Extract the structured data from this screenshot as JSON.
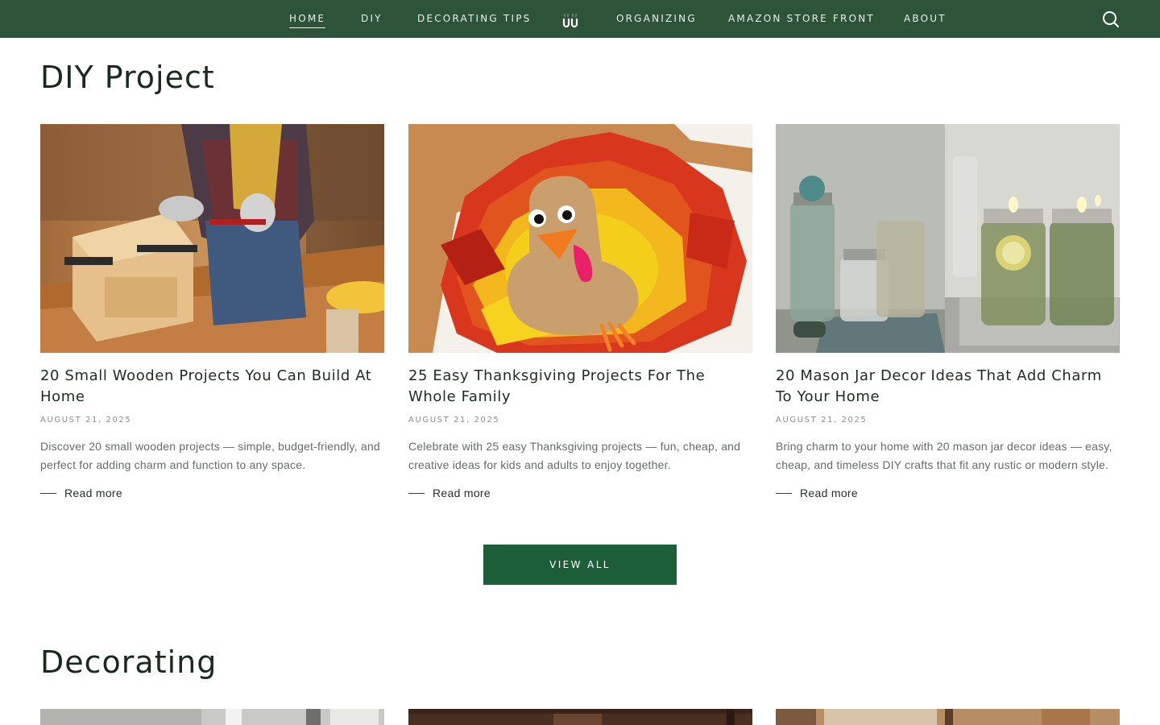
{
  "nav": {
    "items": [
      {
        "label": "HOME",
        "active": true
      },
      {
        "label": "DIY"
      },
      {
        "label": "DECORATING TIPS"
      },
      {
        "label": "ORGANIZING"
      },
      {
        "label": "AMAZON STORE FRONT"
      },
      {
        "label": "ABOUT"
      }
    ],
    "logo_icon": "uu-logo-icon",
    "search_icon": "search-icon",
    "background": "#2d5339"
  },
  "sections": {
    "diy": {
      "title": "DIY Project",
      "cards": [
        {
          "title": "20 Small Wooden Projects You Can Build At Home",
          "date": "AUGUST 21, 2025",
          "excerpt": "Discover 20 small wooden projects — simple, budget-friendly, and perfect for adding charm and function to any space.",
          "read_more": "Read more"
        },
        {
          "title": "25 Easy Thanksgiving Projects For The Whole Family",
          "date": "AUGUST 21, 2025",
          "excerpt": "Celebrate with 25 easy Thanksgiving projects — fun, cheap, and creative ideas for kids and adults to enjoy together.",
          "read_more": "Read more"
        },
        {
          "title": "20 Mason Jar Decor Ideas That Add Charm To Your Home",
          "date": "AUGUST 21, 2025",
          "excerpt": "Bring charm to your home with 20 mason jar decor ideas — easy, cheap, and timeless DIY crafts that fit any rustic or modern style.",
          "read_more": "Read more"
        }
      ],
      "view_all": "VIEW ALL"
    },
    "decorating": {
      "title": "Decorating"
    }
  },
  "colors": {
    "accent": "#1c5e38",
    "nav": "#2d5339",
    "heading": "#1a2a20",
    "muted": "#8b8f8c"
  }
}
